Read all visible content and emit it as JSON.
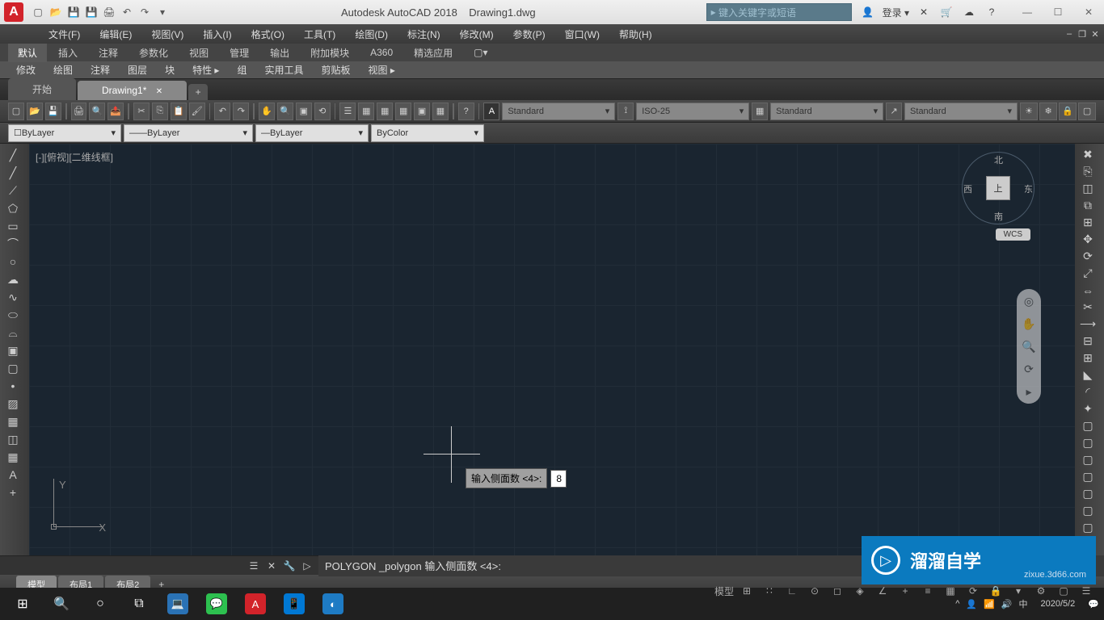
{
  "title": {
    "app": "Autodesk AutoCAD 2018",
    "file": "Drawing1.dwg",
    "search_placeholder": "键入关键字或短语",
    "login": "登录"
  },
  "menu": {
    "items": [
      "文件(F)",
      "编辑(E)",
      "视图(V)",
      "插入(I)",
      "格式(O)",
      "工具(T)",
      "绘图(D)",
      "标注(N)",
      "修改(M)",
      "参数(P)",
      "窗口(W)",
      "帮助(H)"
    ]
  },
  "ribbon_tabs": {
    "items": [
      "默认",
      "插入",
      "注释",
      "参数化",
      "视图",
      "管理",
      "输出",
      "附加模块",
      "A360",
      "精选应用"
    ],
    "active": 0
  },
  "ribbon_panels": {
    "items": [
      "修改",
      "绘图",
      "注释",
      "图层",
      "块",
      "特性 ▸",
      "组",
      "实用工具",
      "剪贴板",
      "视图 ▸"
    ]
  },
  "doc_tabs": {
    "items": [
      "开始",
      "Drawing1*"
    ],
    "active": 1
  },
  "text_styles": {
    "text": "Standard",
    "dim": "ISO-25",
    "table": "Standard",
    "mleader": "Standard"
  },
  "layer_row": {
    "layer": "ByLayer",
    "color": "ByLayer",
    "linetype": "ByLayer",
    "lineweight": "ByColor"
  },
  "viewport": {
    "label": "[-][俯视][二维线框]"
  },
  "dynamic_input": {
    "prompt": "输入侧面数 <4>:",
    "value": "8"
  },
  "ucs": {
    "x": "X",
    "y": "Y"
  },
  "navcube": {
    "top": "上",
    "n": "北",
    "s": "南",
    "e": "东",
    "w": "西",
    "wcs": "WCS"
  },
  "command": {
    "text": "POLYGON _polygon 输入侧面数 <4>:"
  },
  "model_tabs": {
    "items": [
      "模型",
      "布局1",
      "布局2"
    ],
    "active": 0
  },
  "status": {
    "model": "模型"
  },
  "watermark": {
    "text": "溜溜自学",
    "url": "zixue.3d66.com"
  },
  "taskbar": {
    "date": "2020/5/2"
  }
}
